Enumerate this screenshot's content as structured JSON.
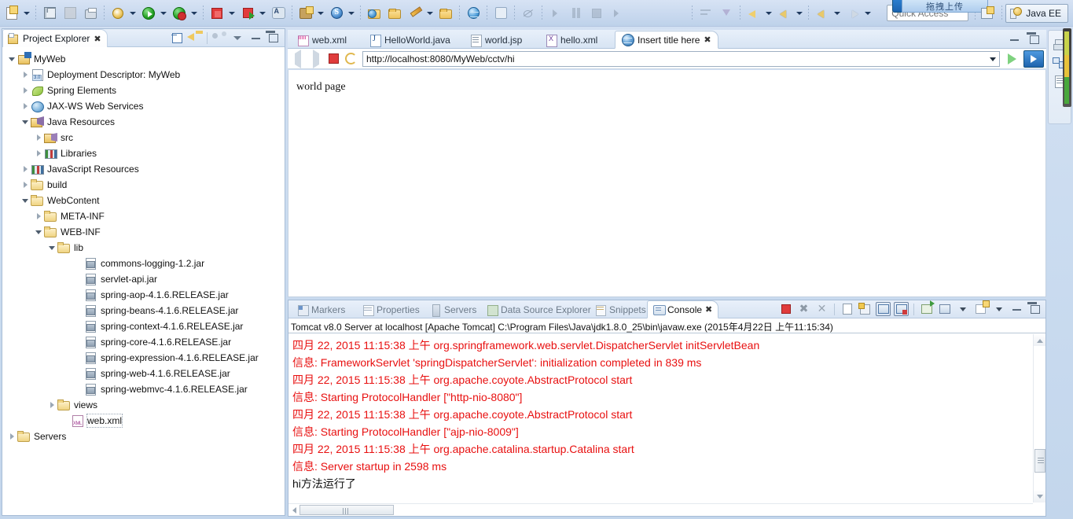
{
  "toolbar": {
    "items": [
      {
        "name": "new-wizard-button",
        "icon": "new-file-icon",
        "dropdown": true
      },
      {
        "name": "save-button",
        "icon": "save-icon",
        "dropdown": false
      },
      {
        "name": "save-all-button",
        "icon": "save-all-icon",
        "dropdown": false
      },
      {
        "name": "print-button",
        "icon": "print-icon",
        "dropdown": false
      },
      {
        "name": "debug-button",
        "icon": "bug-icon",
        "dropdown": true
      },
      {
        "name": "run-button",
        "icon": "run-green-icon",
        "dropdown": true
      },
      {
        "name": "run-server-button",
        "icon": "run-server-icon",
        "dropdown": true
      },
      {
        "name": "stop-button",
        "icon": "stop-red-icon",
        "dropdown": true
      },
      {
        "name": "run-last-button",
        "icon": "run-red-icon",
        "dropdown": true
      },
      {
        "name": "new-annotation-button",
        "icon": "annotation-icon",
        "dropdown": false
      },
      {
        "name": "new-java-ee-button",
        "icon": "package-wizard-icon",
        "dropdown": true
      },
      {
        "name": "spring-button",
        "icon": "spring-s-icon",
        "dropdown": true
      },
      {
        "name": "open-type-button",
        "icon": "open-type-icon",
        "dropdown": false
      },
      {
        "name": "open-resource-button",
        "icon": "open-folder-icon",
        "dropdown": false
      },
      {
        "name": "search-button",
        "icon": "pencil-icon",
        "dropdown": true
      },
      {
        "name": "open-task-button",
        "icon": "open-task-icon",
        "dropdown": false
      },
      {
        "name": "web-browser-button",
        "icon": "globe-icon",
        "dropdown": false
      },
      {
        "name": "jump-button",
        "icon": "tree-jump-icon",
        "dropdown": false
      },
      {
        "name": "skip-breakpoints-button",
        "icon": "skip-breakpoints-icon",
        "dropdown": false
      },
      {
        "name": "resume-button",
        "icon": "resume-icon",
        "dropdown": false
      },
      {
        "name": "suspend-button",
        "icon": "pause-icon",
        "dropdown": false
      },
      {
        "name": "terminate-button",
        "icon": "terminate-icon",
        "dropdown": false
      },
      {
        "name": "step-into-button",
        "icon": "step-into-icon",
        "dropdown": false
      },
      {
        "name": "step-over-button",
        "icon": "step-over-icon",
        "dropdown": false
      },
      {
        "name": "step-return-button",
        "icon": "step-return-icon",
        "dropdown": false
      },
      {
        "name": "drop-to-frame-button",
        "icon": "drop-to-frame-icon",
        "dropdown": false
      },
      {
        "name": "outline-button",
        "icon": "lines-icon",
        "dropdown": false
      },
      {
        "name": "filter-button",
        "icon": "filter-icon",
        "dropdown": false
      },
      {
        "name": "next-annotation-button",
        "icon": "next-annotation-icon",
        "dropdown": true
      },
      {
        "name": "previous-annotation-button",
        "icon": "previous-annotation-icon",
        "dropdown": true
      },
      {
        "name": "back-button",
        "icon": "back-arrow-icon",
        "dropdown": true
      },
      {
        "name": "forward-button",
        "icon": "forward-arrow-icon",
        "dropdown": true
      }
    ],
    "quick_access_placeholder": "Quick Access",
    "upload_tooltip": "拖拽上传",
    "perspective_label": "Java EE"
  },
  "project_explorer": {
    "title": "Project Explorer",
    "toolbar": [
      "collapse-all",
      "link-with-editor",
      "view-menu-dots",
      "view-menu",
      "minimize",
      "maximize"
    ],
    "tree": [
      {
        "label": "MyWeb",
        "indent": 0,
        "twist": "open",
        "icon": "project-icon"
      },
      {
        "label": "Deployment Descriptor: MyWeb",
        "indent": 1,
        "twist": "closed",
        "icon": "deployment-descriptor-icon"
      },
      {
        "label": "Spring Elements",
        "indent": 1,
        "twist": "closed",
        "icon": "spring-leaf-icon"
      },
      {
        "label": "JAX-WS Web Services",
        "indent": 1,
        "twist": "closed",
        "icon": "web-service-icon"
      },
      {
        "label": "Java Resources",
        "indent": 1,
        "twist": "open",
        "icon": "java-resources-icon"
      },
      {
        "label": "src",
        "indent": 2,
        "twist": "closed",
        "icon": "source-folder-icon"
      },
      {
        "label": "Libraries",
        "indent": 2,
        "twist": "closed",
        "icon": "libraries-icon"
      },
      {
        "label": "JavaScript Resources",
        "indent": 1,
        "twist": "closed",
        "icon": "js-libraries-icon"
      },
      {
        "label": "build",
        "indent": 1,
        "twist": "closed",
        "icon": "folder-icon"
      },
      {
        "label": "WebContent",
        "indent": 1,
        "twist": "open",
        "icon": "folder-icon"
      },
      {
        "label": "META-INF",
        "indent": 2,
        "twist": "closed",
        "icon": "folder-icon"
      },
      {
        "label": "WEB-INF",
        "indent": 2,
        "twist": "open",
        "icon": "folder-icon"
      },
      {
        "label": "lib",
        "indent": 3,
        "twist": "open",
        "icon": "folder-icon"
      },
      {
        "label": "commons-logging-1.2.jar",
        "indent": 5,
        "twist": "none",
        "icon": "jar-icon"
      },
      {
        "label": "servlet-api.jar",
        "indent": 5,
        "twist": "none",
        "icon": "jar-icon"
      },
      {
        "label": "spring-aop-4.1.6.RELEASE.jar",
        "indent": 5,
        "twist": "none",
        "icon": "jar-icon"
      },
      {
        "label": "spring-beans-4.1.6.RELEASE.jar",
        "indent": 5,
        "twist": "none",
        "icon": "jar-icon"
      },
      {
        "label": "spring-context-4.1.6.RELEASE.jar",
        "indent": 5,
        "twist": "none",
        "icon": "jar-icon"
      },
      {
        "label": "spring-core-4.1.6.RELEASE.jar",
        "indent": 5,
        "twist": "none",
        "icon": "jar-icon"
      },
      {
        "label": "spring-expression-4.1.6.RELEASE.jar",
        "indent": 5,
        "twist": "none",
        "icon": "jar-icon"
      },
      {
        "label": "spring-web-4.1.6.RELEASE.jar",
        "indent": 5,
        "twist": "none",
        "icon": "jar-icon"
      },
      {
        "label": "spring-webmvc-4.1.6.RELEASE.jar",
        "indent": 5,
        "twist": "none",
        "icon": "jar-icon"
      },
      {
        "label": "views",
        "indent": 3,
        "twist": "closed",
        "icon": "folder-icon"
      },
      {
        "label": "web.xml",
        "indent": 4,
        "twist": "none",
        "icon": "xml-icon",
        "selected": true
      },
      {
        "label": "Servers",
        "indent": 0,
        "twist": "closed",
        "icon": "folder-icon"
      }
    ]
  },
  "editor": {
    "tabs": [
      {
        "label": "web.xml",
        "icon": "xml-file-icon",
        "active": false
      },
      {
        "label": "HelloWorld.java",
        "icon": "java-file-icon",
        "active": false
      },
      {
        "label": "world.jsp",
        "icon": "jsp-file-icon",
        "active": false
      },
      {
        "label": "hello.xml",
        "icon": "x-file-icon",
        "active": false
      },
      {
        "label": "Insert title here",
        "icon": "web-browser-icon",
        "active": true,
        "closable": true
      }
    ],
    "tools": [
      "minimize",
      "maximize"
    ],
    "browser": {
      "url": "http://localhost:8080/MyWeb/cctv/hi",
      "buttons": [
        "back",
        "forward",
        "stop",
        "refresh",
        "go",
        "open-external"
      ],
      "page_content": "world page"
    }
  },
  "console_panel": {
    "tabs": [
      {
        "label": "Markers",
        "icon": "markers-icon",
        "active": false
      },
      {
        "label": "Properties",
        "icon": "properties-icon",
        "active": false
      },
      {
        "label": "Servers",
        "icon": "servers-icon",
        "active": false
      },
      {
        "label": "Data Source Explorer",
        "icon": "data-source-icon",
        "active": false
      },
      {
        "label": "Snippets",
        "icon": "snippets-icon",
        "active": false
      },
      {
        "label": "Console",
        "icon": "console-icon",
        "active": true,
        "closable": true
      }
    ],
    "tools": [
      "terminate",
      "remove-launch",
      "remove-all-launches",
      "clear-console",
      "scroll-lock",
      "show-console-on-output",
      "show-console-on-error",
      "open-console",
      "display-selected-console",
      "new-console-view",
      "minimize",
      "maximize"
    ],
    "status_line": "Tomcat v8.0 Server at localhost [Apache Tomcat] C:\\Program Files\\Java\\jdk1.8.0_25\\bin\\javaw.exe (2015年4月22日 上午11:15:34)",
    "lines": [
      {
        "text": "四月 22, 2015 11:15:38 上午 org.springframework.web.servlet.DispatcherServlet initServletBean",
        "type": "err"
      },
      {
        "text": "信息: FrameworkServlet 'springDispatcherServlet': initialization completed in 839 ms",
        "type": "err"
      },
      {
        "text": "四月 22, 2015 11:15:38 上午 org.apache.coyote.AbstractProtocol start",
        "type": "err"
      },
      {
        "text": "信息: Starting ProtocolHandler [\"http-nio-8080\"]",
        "type": "err"
      },
      {
        "text": "四月 22, 2015 11:15:38 上午 org.apache.coyote.AbstractProtocol start",
        "type": "err"
      },
      {
        "text": "信息: Starting ProtocolHandler [\"ajp-nio-8009\"]",
        "type": "err"
      },
      {
        "text": "四月 22, 2015 11:15:38 上午 org.apache.catalina.startup.Catalina start",
        "type": "err"
      },
      {
        "text": "信息: Server startup in 2598 ms",
        "type": "err"
      },
      {
        "text": "hi方法运行了",
        "type": "out"
      }
    ]
  },
  "fast_view": {
    "items": [
      "servers-fastview-icon",
      "project-explorer-fastview-icon",
      "outline-fastview-icon"
    ]
  },
  "colors": {
    "console_error": "#e81010",
    "console_output": "#111111",
    "chrome": "#cbdcf0",
    "accent": "#1d63ad"
  }
}
